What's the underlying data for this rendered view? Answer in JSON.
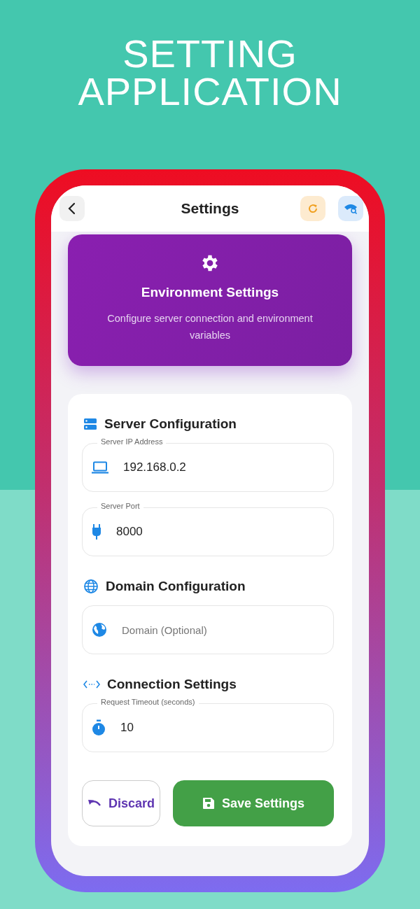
{
  "headline": [
    "SETTING",
    "APPLICATION"
  ],
  "header": {
    "title": "Settings"
  },
  "banner": {
    "title": "Environment Settings",
    "subtitle": "Configure server connection and environment variables"
  },
  "sections": [
    {
      "title": "Server Configuration",
      "fields": [
        {
          "label": "Server IP Address",
          "value": "192.168.0.2"
        },
        {
          "label": "Server Port",
          "value": "8000"
        }
      ]
    },
    {
      "title": "Domain Configuration",
      "fields": [
        {
          "placeholder": "Domain (Optional)"
        }
      ]
    },
    {
      "title": "Connection Settings",
      "fields": [
        {
          "label": "Request Timeout (seconds)",
          "value": "10"
        }
      ]
    }
  ],
  "buttons": [
    {
      "label": "Discard",
      "kind": "outline"
    },
    {
      "label": "Save Settings",
      "kind": "primary"
    }
  ]
}
